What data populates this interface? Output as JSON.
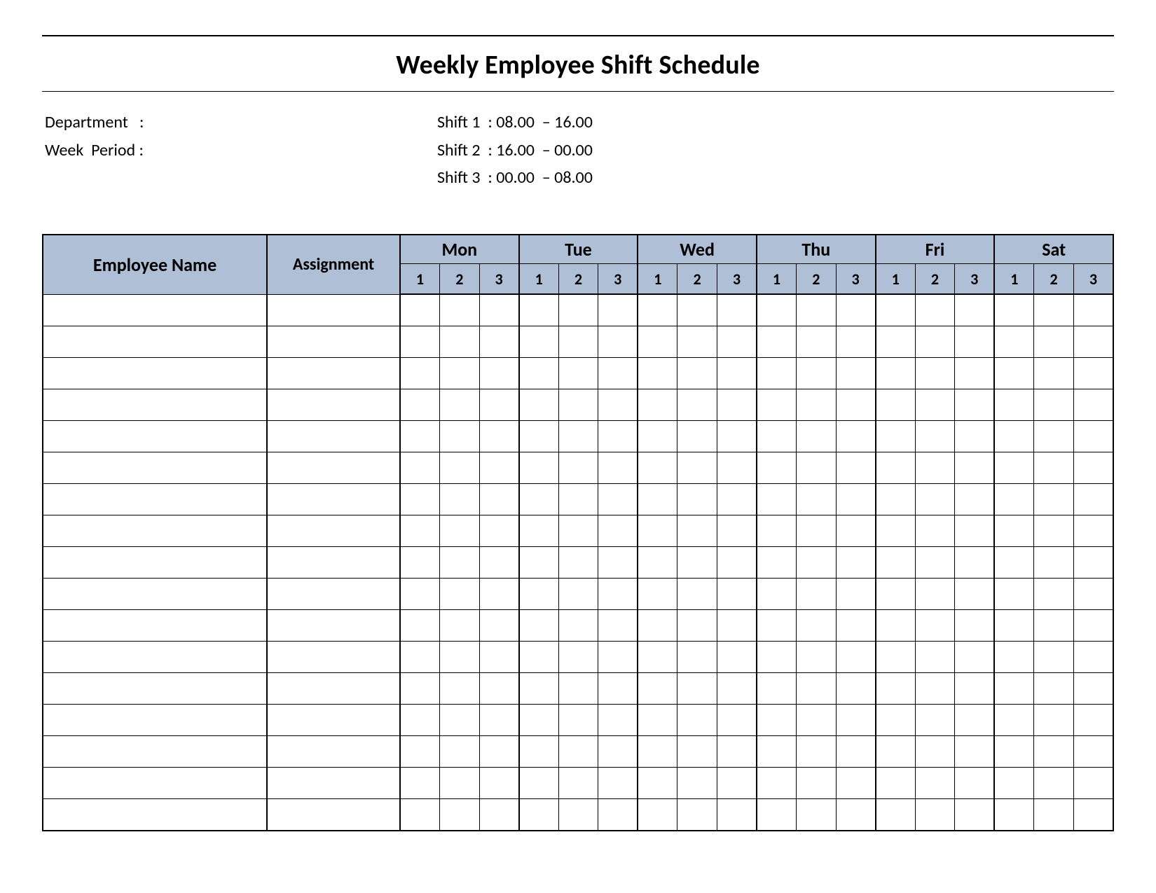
{
  "title": "Weekly Employee Shift Schedule",
  "meta": {
    "department_label": "Department   :",
    "week_period_label": "Week  Period :",
    "shift_lines": [
      "Shift 1  : 08.00  – 16.00",
      "Shift 2  : 16.00  – 00.00",
      "Shift 3  : 00.00  – 08.00"
    ]
  },
  "table": {
    "col_employee": "Employee Name",
    "col_assignment": "Assignment",
    "days": [
      "Mon",
      "Tue",
      "Wed",
      "Thu",
      "Fri",
      "Sat"
    ],
    "shift_numbers": [
      "1",
      "2",
      "3"
    ],
    "row_count": 17
  },
  "colors": {
    "header_fill": "#aebfd6"
  }
}
